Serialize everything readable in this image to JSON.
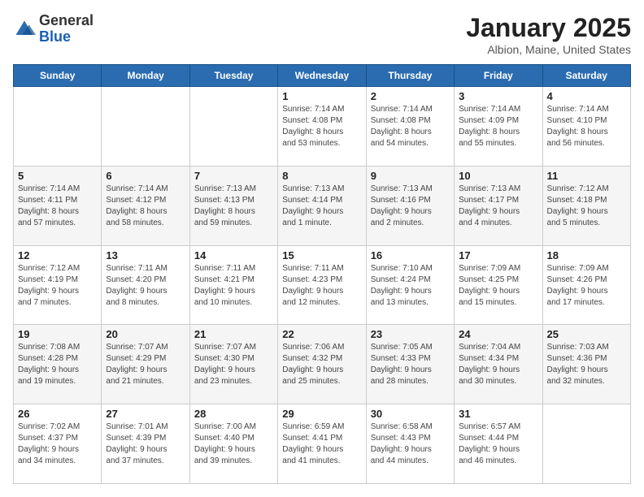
{
  "logo": {
    "general": "General",
    "blue": "Blue"
  },
  "title": "January 2025",
  "subtitle": "Albion, Maine, United States",
  "days_of_week": [
    "Sunday",
    "Monday",
    "Tuesday",
    "Wednesday",
    "Thursday",
    "Friday",
    "Saturday"
  ],
  "weeks": [
    [
      {
        "day": "",
        "info": ""
      },
      {
        "day": "",
        "info": ""
      },
      {
        "day": "",
        "info": ""
      },
      {
        "day": "1",
        "info": "Sunrise: 7:14 AM\nSunset: 4:08 PM\nDaylight: 8 hours\nand 53 minutes."
      },
      {
        "day": "2",
        "info": "Sunrise: 7:14 AM\nSunset: 4:08 PM\nDaylight: 8 hours\nand 54 minutes."
      },
      {
        "day": "3",
        "info": "Sunrise: 7:14 AM\nSunset: 4:09 PM\nDaylight: 8 hours\nand 55 minutes."
      },
      {
        "day": "4",
        "info": "Sunrise: 7:14 AM\nSunset: 4:10 PM\nDaylight: 8 hours\nand 56 minutes."
      }
    ],
    [
      {
        "day": "5",
        "info": "Sunrise: 7:14 AM\nSunset: 4:11 PM\nDaylight: 8 hours\nand 57 minutes."
      },
      {
        "day": "6",
        "info": "Sunrise: 7:14 AM\nSunset: 4:12 PM\nDaylight: 8 hours\nand 58 minutes."
      },
      {
        "day": "7",
        "info": "Sunrise: 7:13 AM\nSunset: 4:13 PM\nDaylight: 8 hours\nand 59 minutes."
      },
      {
        "day": "8",
        "info": "Sunrise: 7:13 AM\nSunset: 4:14 PM\nDaylight: 9 hours\nand 1 minute."
      },
      {
        "day": "9",
        "info": "Sunrise: 7:13 AM\nSunset: 4:16 PM\nDaylight: 9 hours\nand 2 minutes."
      },
      {
        "day": "10",
        "info": "Sunrise: 7:13 AM\nSunset: 4:17 PM\nDaylight: 9 hours\nand 4 minutes."
      },
      {
        "day": "11",
        "info": "Sunrise: 7:12 AM\nSunset: 4:18 PM\nDaylight: 9 hours\nand 5 minutes."
      }
    ],
    [
      {
        "day": "12",
        "info": "Sunrise: 7:12 AM\nSunset: 4:19 PM\nDaylight: 9 hours\nand 7 minutes."
      },
      {
        "day": "13",
        "info": "Sunrise: 7:11 AM\nSunset: 4:20 PM\nDaylight: 9 hours\nand 8 minutes."
      },
      {
        "day": "14",
        "info": "Sunrise: 7:11 AM\nSunset: 4:21 PM\nDaylight: 9 hours\nand 10 minutes."
      },
      {
        "day": "15",
        "info": "Sunrise: 7:11 AM\nSunset: 4:23 PM\nDaylight: 9 hours\nand 12 minutes."
      },
      {
        "day": "16",
        "info": "Sunrise: 7:10 AM\nSunset: 4:24 PM\nDaylight: 9 hours\nand 13 minutes."
      },
      {
        "day": "17",
        "info": "Sunrise: 7:09 AM\nSunset: 4:25 PM\nDaylight: 9 hours\nand 15 minutes."
      },
      {
        "day": "18",
        "info": "Sunrise: 7:09 AM\nSunset: 4:26 PM\nDaylight: 9 hours\nand 17 minutes."
      }
    ],
    [
      {
        "day": "19",
        "info": "Sunrise: 7:08 AM\nSunset: 4:28 PM\nDaylight: 9 hours\nand 19 minutes."
      },
      {
        "day": "20",
        "info": "Sunrise: 7:07 AM\nSunset: 4:29 PM\nDaylight: 9 hours\nand 21 minutes."
      },
      {
        "day": "21",
        "info": "Sunrise: 7:07 AM\nSunset: 4:30 PM\nDaylight: 9 hours\nand 23 minutes."
      },
      {
        "day": "22",
        "info": "Sunrise: 7:06 AM\nSunset: 4:32 PM\nDaylight: 9 hours\nand 25 minutes."
      },
      {
        "day": "23",
        "info": "Sunrise: 7:05 AM\nSunset: 4:33 PM\nDaylight: 9 hours\nand 28 minutes."
      },
      {
        "day": "24",
        "info": "Sunrise: 7:04 AM\nSunset: 4:34 PM\nDaylight: 9 hours\nand 30 minutes."
      },
      {
        "day": "25",
        "info": "Sunrise: 7:03 AM\nSunset: 4:36 PM\nDaylight: 9 hours\nand 32 minutes."
      }
    ],
    [
      {
        "day": "26",
        "info": "Sunrise: 7:02 AM\nSunset: 4:37 PM\nDaylight: 9 hours\nand 34 minutes."
      },
      {
        "day": "27",
        "info": "Sunrise: 7:01 AM\nSunset: 4:39 PM\nDaylight: 9 hours\nand 37 minutes."
      },
      {
        "day": "28",
        "info": "Sunrise: 7:00 AM\nSunset: 4:40 PM\nDaylight: 9 hours\nand 39 minutes."
      },
      {
        "day": "29",
        "info": "Sunrise: 6:59 AM\nSunset: 4:41 PM\nDaylight: 9 hours\nand 41 minutes."
      },
      {
        "day": "30",
        "info": "Sunrise: 6:58 AM\nSunset: 4:43 PM\nDaylight: 9 hours\nand 44 minutes."
      },
      {
        "day": "31",
        "info": "Sunrise: 6:57 AM\nSunset: 4:44 PM\nDaylight: 9 hours\nand 46 minutes."
      },
      {
        "day": "",
        "info": ""
      }
    ]
  ]
}
